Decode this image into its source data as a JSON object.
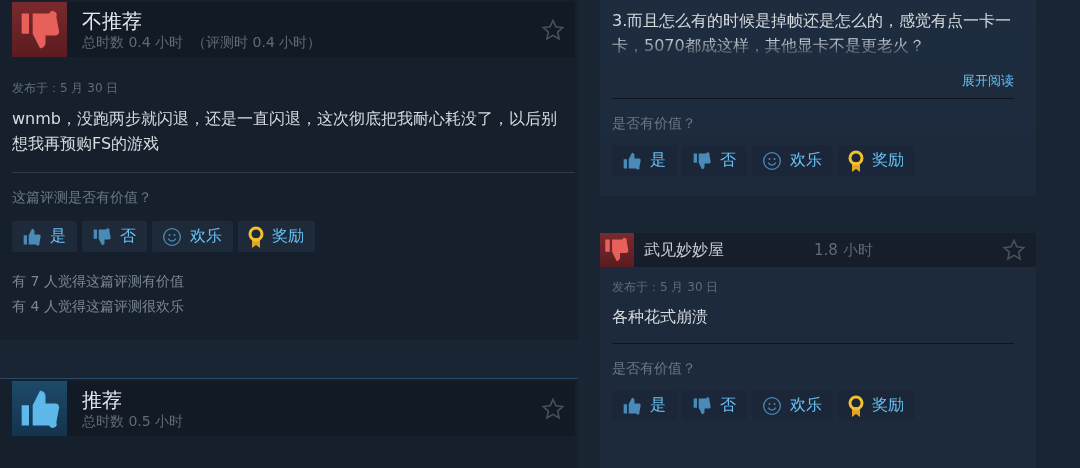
{
  "left_reviews": [
    {
      "recommended": false,
      "verdict": "不推荐",
      "playtime": "总时数 0.4 小时",
      "playtime_at_review": "（评测时 0.4 小时）",
      "posted": "发布于：5 月 30 日",
      "body": "wnmb，没跑两步就闪退，还是一直闪退，这次彻底把我耐心耗没了，以后别想我再预购FS的游戏",
      "question": "这篇评测是否有价值？",
      "votes": [
        {
          "kind": "yes",
          "label": "是"
        },
        {
          "kind": "no",
          "label": "否"
        },
        {
          "kind": "funny",
          "label": "欢乐"
        },
        {
          "kind": "award",
          "label": "奖励"
        }
      ],
      "stats": [
        "有 7 人觉得这篇评测有价值",
        "有 4 人觉得这篇评测很欢乐"
      ]
    },
    {
      "recommended": true,
      "verdict": "推荐",
      "playtime": "总时数 0.5 小时"
    }
  ],
  "right_reviews": [
    {
      "body": "3.而且怎么有的时候是掉帧还是怎么的，感觉有点一卡一卡，5070都成这样，其他显卡不是更老火？",
      "expand_link": "展开阅读",
      "question": "是否有价值？",
      "votes": [
        {
          "kind": "yes",
          "label": "是"
        },
        {
          "kind": "no",
          "label": "否"
        },
        {
          "kind": "funny",
          "label": "欢乐"
        },
        {
          "kind": "award",
          "label": "奖励"
        }
      ]
    },
    {
      "recommended": false,
      "author": "武见妙妙屋",
      "playtime": "1.8 小时",
      "posted": "发布于：5 月 30 日",
      "body": "各种花式崩溃",
      "question": "是否有价值？",
      "votes": [
        {
          "kind": "yes",
          "label": "是"
        },
        {
          "kind": "no",
          "label": "否"
        },
        {
          "kind": "funny",
          "label": "欢乐"
        },
        {
          "kind": "award",
          "label": "奖励"
        }
      ]
    }
  ]
}
